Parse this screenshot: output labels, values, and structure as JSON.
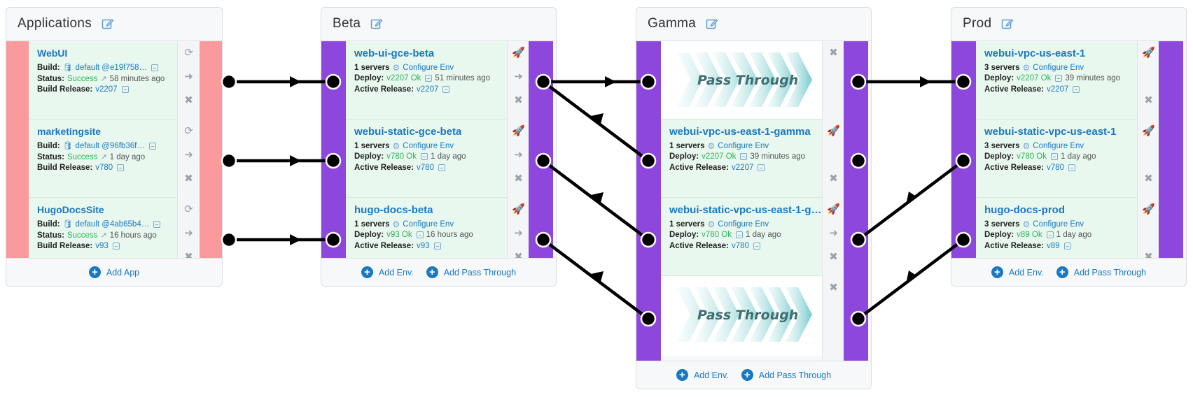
{
  "panels": {
    "applications": {
      "title": "Applications",
      "footer": {
        "add_app": "Add App"
      },
      "rows": [
        {
          "name": "WebUI",
          "build_label": "Build:",
          "build_value": "default @e19f758…",
          "status_label": "Status:",
          "status_value": "Success",
          "status_time": "58 minutes ago",
          "release_label": "Build Release:",
          "release_value": "v2207"
        },
        {
          "name": "marketingsite",
          "build_label": "Build:",
          "build_value": "default @96fb36f…",
          "status_label": "Status:",
          "status_value": "Success",
          "status_time": "1 day ago",
          "release_label": "Build Release:",
          "release_value": "v780"
        },
        {
          "name": "HugoDocsSite",
          "build_label": "Build:",
          "build_value": "default @4ab65b4…",
          "status_label": "Status:",
          "status_value": "Success",
          "status_time": "16 hours ago",
          "release_label": "Build Release:",
          "release_value": "v93"
        }
      ]
    },
    "beta": {
      "title": "Beta",
      "footer": {
        "add_env": "Add Env.",
        "add_pass": "Add Pass Through"
      },
      "rows": [
        {
          "name": "web-ui-gce-beta",
          "servers": "1 servers",
          "configure": "Configure Env",
          "deploy_label": "Deploy:",
          "deploy_value": "v2207 Ok",
          "deploy_time": "51 minutes ago",
          "active_label": "Active Release:",
          "active_value": "v2207"
        },
        {
          "name": "webui-static-gce-beta",
          "servers": "1 servers",
          "configure": "Configure Env",
          "deploy_label": "Deploy:",
          "deploy_value": "v780 Ok",
          "deploy_time": "1 day ago",
          "active_label": "Active Release:",
          "active_value": "v780"
        },
        {
          "name": "hugo-docs-beta",
          "servers": "1 servers",
          "configure": "Configure Env",
          "deploy_label": "Deploy:",
          "deploy_value": "v93 Ok",
          "deploy_time": "16 hours ago",
          "active_label": "Active Release:",
          "active_value": "v93"
        }
      ]
    },
    "gamma": {
      "title": "Gamma",
      "footer": {
        "add_env": "Add Env.",
        "add_pass": "Add Pass Through"
      },
      "pass_through_label": "Pass Through",
      "rows": [
        {
          "name": "webui-vpc-us-east-1-gamma",
          "servers": "1 servers",
          "configure": "Configure Env",
          "deploy_label": "Deploy:",
          "deploy_value": "v2207 Ok",
          "deploy_time": "39 minutes ago",
          "active_label": "Active Release:",
          "active_value": "v2207"
        },
        {
          "name": "webui-static-vpc-us-east-1-g…",
          "servers": "1 servers",
          "configure": "Configure Env",
          "deploy_label": "Deploy:",
          "deploy_value": "v780 Ok",
          "deploy_time": "1 day ago",
          "active_label": "Active Release:",
          "active_value": "v780"
        }
      ]
    },
    "prod": {
      "title": "Prod",
      "footer": {
        "add_env": "Add Env.",
        "add_pass": "Add Pass Through"
      },
      "rows": [
        {
          "name": "webui-vpc-us-east-1",
          "servers": "3 servers",
          "configure": "Configure Env",
          "deploy_label": "Deploy:",
          "deploy_value": "v2207 Ok",
          "deploy_time": "39 minutes ago",
          "active_label": "Active Release:",
          "active_value": "v2207"
        },
        {
          "name": "webui-static-vpc-us-east-1",
          "servers": "3 servers",
          "configure": "Configure Env",
          "deploy_label": "Deploy:",
          "deploy_value": "v780 Ok",
          "deploy_time": "1 day ago",
          "active_label": "Active Release:",
          "active_value": "v780"
        },
        {
          "name": "hugo-docs-prod",
          "servers": "3 servers",
          "configure": "Configure Env",
          "deploy_label": "Deploy:",
          "deploy_value": "v89 Ok",
          "deploy_time": "1 day ago",
          "active_label": "Active Release:",
          "active_value": "v89"
        }
      ]
    }
  },
  "colors": {
    "app_strip": "#fa9a9c",
    "env_strip": "#8e47dd",
    "env_row_bg": "#e9f8ef",
    "link": "#1a78c2",
    "ok": "#2cb35b",
    "connector": "#000000"
  },
  "icons": {
    "edit": "edit-icon",
    "refresh": "refresh-icon",
    "promote": "arrow-circle-right-icon",
    "remove": "close-icon",
    "deploy": "rocket-icon",
    "build": "cup-icon",
    "configure": "gear-icon",
    "add": "plus-circle-icon",
    "external": "external-link-icon"
  }
}
